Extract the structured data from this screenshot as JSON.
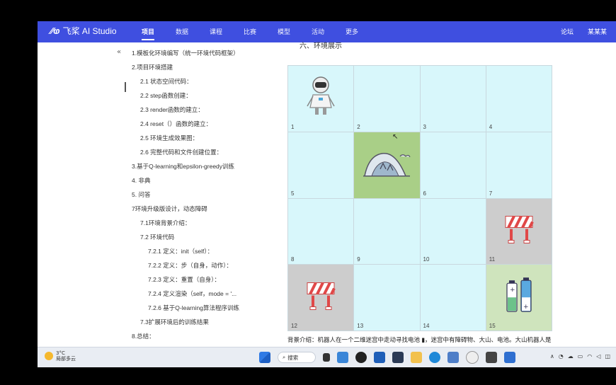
{
  "header": {
    "logo_text": "飞桨 AI Studio",
    "nav": [
      "项目",
      "数据",
      "课程",
      "比赛",
      "模型",
      "活动",
      "更多"
    ],
    "active_nav": "项目",
    "right": [
      "论坛",
      "某某某"
    ]
  },
  "toc": {
    "collapse_glyph": "«",
    "items": [
      "1.模板化环境编写（统一环境代码框架）",
      "2.项目环境搭建",
      "2.1 状态空间代码：",
      "2.2 step函数创建：",
      "2.3 render函数的建立：",
      "2.4 reset（）函数的建立：",
      "2.5 环境生成效果图：",
      "2.6 完整代码和文件创建位置：",
      "3.基于Q-learning和epsilon-greedy训练",
      "4. 非典",
      "5. 问答",
      "7环境升级版设计，动态障碍",
      "7.1环境背景介绍：",
      "7.2 环境代码",
      "7.2.1 定义：init（self）：",
      "7.2.2 定义：步（自身，动作）：",
      "7.2.3 定义：重置（自身）：",
      "7.2.4 定义渲染（self，mode = '...",
      "7.2.6 基于Q-learning算法程序训练",
      "7.3扩展环境后的训练结果",
      "8.总结："
    ]
  },
  "content": {
    "heading_partial": "六、环境展示",
    "cells": [
      "1",
      "2",
      "3",
      "4",
      "5",
      "6",
      "7",
      "8",
      "9",
      "10",
      "11",
      "12",
      "13",
      "14",
      "15"
    ],
    "caption": "背景介绍：机器人在一个二维迷宫中走动寻找电池 ▮，迷宫中有障碍物、大山、电池。大山机器人是"
  },
  "taskbar": {
    "weather_temp": "3°C",
    "weather_desc": "局部多云",
    "search_label": "搜索"
  },
  "colors": {
    "brand": "#3f4fe0",
    "cell": "#d8f7fb",
    "mountain": "#a9cf87",
    "obstacle": "#cdcdcd",
    "battery": "#cfe4bd"
  }
}
